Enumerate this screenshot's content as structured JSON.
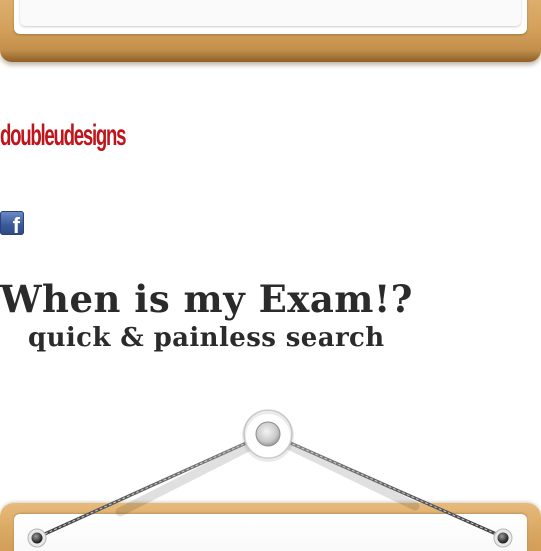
{
  "header": {
    "logo_text": "doubleudesigns",
    "social": {
      "facebook_icon_letter": "f"
    }
  },
  "hero": {
    "title": "When is my Exam!?",
    "subtitle": "quick & painless search"
  },
  "colors": {
    "logo_red": "#c0141b",
    "heading_text": "#2b2b2b",
    "wood": "#d9a862",
    "facebook_blue": "#3b5998"
  },
  "icons": {
    "facebook": "facebook-icon",
    "hook": "hook-icon",
    "nail": "nail-icon"
  }
}
